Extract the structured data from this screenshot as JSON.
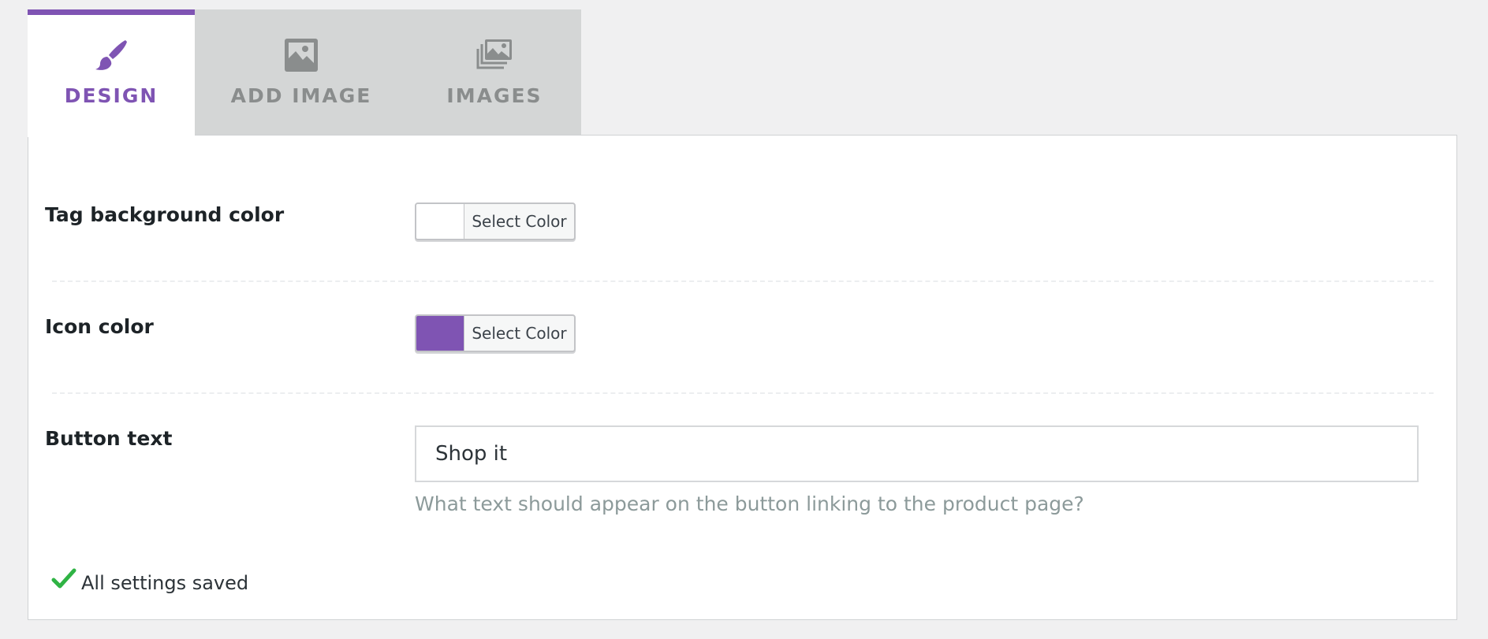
{
  "tabs": [
    {
      "label": "DESIGN",
      "icon": "paintbrush-icon",
      "active": true
    },
    {
      "label": "ADD IMAGE",
      "icon": "image-icon",
      "active": false
    },
    {
      "label": "IMAGES",
      "icon": "images-stack-icon",
      "active": false
    }
  ],
  "settings": {
    "tag_bg": {
      "label": "Tag background color",
      "button_label": "Select Color",
      "color": "#ffffff"
    },
    "icon_color": {
      "label": "Icon color",
      "button_label": "Select Color",
      "color": "#7f54b3"
    },
    "button_text": {
      "label": "Button text",
      "value": "Shop it",
      "help": "What text should appear on the button linking to the product page?"
    }
  },
  "status": {
    "text": "All settings saved",
    "icon": "checkmark-icon"
  },
  "colors": {
    "accent": "#7f54b3",
    "success": "#2fb344",
    "tab_inactive_bg": "#d4d6d6"
  }
}
